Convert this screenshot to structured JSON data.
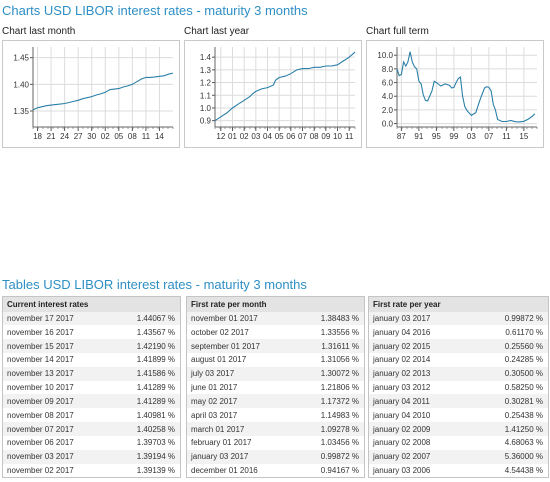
{
  "headings": {
    "charts": "Charts USD LIBOR interest rates - maturity 3 months",
    "tables": "Tables USD LIBOR interest rates - maturity 3 months"
  },
  "colors": {
    "accent": "#2e8fc5",
    "line": "#2a7fa8",
    "grid": "#dcdcdc"
  },
  "chart_data": [
    {
      "type": "line",
      "title": "Chart last month",
      "xlabel": "",
      "ylabel": "",
      "grid": true,
      "ylim": [
        1.32,
        1.47
      ],
      "xlim": [
        0,
        31
      ],
      "yticks": [
        1.35,
        1.4,
        1.45
      ],
      "ytick_labels": [
        "1.35",
        "1.40",
        "1.45"
      ],
      "x_tick_labels": [
        "18",
        "21",
        "24",
        "27",
        "30",
        "02",
        "05",
        "08",
        "11",
        "14"
      ],
      "x_tick_positions": [
        1,
        4,
        7,
        10,
        13,
        16,
        19,
        22,
        25,
        28
      ],
      "x": [
        0,
        1,
        2,
        3,
        4,
        5,
        6,
        7,
        8,
        9,
        10,
        11,
        12,
        13,
        14,
        15,
        16,
        17,
        18,
        19,
        20,
        21,
        22,
        23,
        24,
        25,
        26,
        27,
        28,
        29,
        30,
        31
      ],
      "values": [
        1.352,
        1.356,
        1.358,
        1.36,
        1.361,
        1.362,
        1.363,
        1.364,
        1.366,
        1.368,
        1.37,
        1.373,
        1.375,
        1.377,
        1.38,
        1.382,
        1.385,
        1.39,
        1.391,
        1.392,
        1.395,
        1.397,
        1.4,
        1.405,
        1.41,
        1.413,
        1.413,
        1.414,
        1.415,
        1.416,
        1.419,
        1.421
      ]
    },
    {
      "type": "line",
      "title": "Chart last year",
      "xlabel": "",
      "ylabel": "",
      "grid": true,
      "ylim": [
        0.85,
        1.48
      ],
      "xlim": [
        0,
        12
      ],
      "yticks": [
        0.9,
        1.0,
        1.1,
        1.2,
        1.3,
        1.4
      ],
      "ytick_labels": [
        "0.9",
        "1.0",
        "1.1",
        "1.2",
        "1.3",
        "1.4"
      ],
      "x_tick_labels": [
        "12",
        "01",
        "02",
        "03",
        "04",
        "05",
        "06",
        "07",
        "08",
        "09",
        "10",
        "11"
      ],
      "x_tick_positions": [
        0.5,
        1.5,
        2.5,
        3.5,
        4.5,
        5.5,
        6.5,
        7.5,
        8.5,
        9.5,
        10.5,
        11.5
      ],
      "x": [
        0,
        0.5,
        1,
        1.5,
        2,
        2.5,
        3,
        3.2,
        3.5,
        4,
        4.5,
        5,
        5.2,
        5.5,
        6,
        6.5,
        7,
        7.5,
        8,
        8.5,
        9,
        9.5,
        10,
        10.5,
        11,
        11.5,
        12
      ],
      "values": [
        0.9,
        0.93,
        0.96,
        1.0,
        1.03,
        1.06,
        1.09,
        1.11,
        1.13,
        1.15,
        1.16,
        1.18,
        1.22,
        1.24,
        1.25,
        1.27,
        1.3,
        1.31,
        1.31,
        1.32,
        1.32,
        1.33,
        1.33,
        1.34,
        1.37,
        1.4,
        1.44
      ]
    },
    {
      "type": "line",
      "title": "Chart full term",
      "xlabel": "",
      "ylabel": "",
      "grid": true,
      "ylim": [
        -0.5,
        11.2
      ],
      "xlim": [
        1986,
        2018
      ],
      "yticks": [
        0,
        2,
        4,
        6,
        8,
        10
      ],
      "ytick_labels": [
        "0.0",
        "2.0",
        "4.0",
        "6.0",
        "8.0",
        "10.0"
      ],
      "x_tick_labels": [
        "87",
        "91",
        "95",
        "99",
        "03",
        "07",
        "11",
        "15"
      ],
      "x_tick_positions": [
        1987,
        1991,
        1995,
        1999,
        2003,
        2007,
        2011,
        2015
      ],
      "x": [
        1986,
        1986.5,
        1987,
        1987.5,
        1988,
        1988.5,
        1989,
        1989.5,
        1990,
        1990.5,
        1991,
        1991.5,
        1992,
        1992.5,
        1993,
        1994,
        1994.5,
        1995,
        1996,
        1997,
        1998,
        1998.5,
        1999,
        1999.5,
        2000,
        2000.5,
        2001,
        2001.5,
        2002,
        2003,
        2004,
        2005,
        2006,
        2006.5,
        2007,
        2007.5,
        2008,
        2008.5,
        2009,
        2010,
        2011,
        2012,
        2013,
        2014,
        2015,
        2016,
        2017,
        2017.5
      ],
      "values": [
        8.0,
        7.0,
        7.2,
        9.0,
        8.4,
        9.0,
        10.5,
        9.0,
        8.3,
        8.0,
        6.2,
        5.8,
        4.2,
        3.4,
        3.3,
        4.8,
        6.2,
        6.0,
        5.5,
        5.8,
        5.6,
        5.2,
        5.3,
        6.0,
        6.6,
        6.8,
        4.0,
        2.5,
        1.9,
        1.2,
        1.6,
        3.5,
        5.2,
        5.4,
        5.3,
        4.8,
        2.8,
        2.0,
        0.6,
        0.3,
        0.3,
        0.45,
        0.28,
        0.24,
        0.33,
        0.65,
        1.1,
        1.44
      ]
    }
  ],
  "tables": [
    {
      "header": "Current interest rates",
      "rows": [
        [
          "november 17 2017",
          "1.44067 %"
        ],
        [
          "november 16 2017",
          "1.43567 %"
        ],
        [
          "november 15 2017",
          "1.42190 %"
        ],
        [
          "november 14 2017",
          "1.41899 %"
        ],
        [
          "november 13 2017",
          "1.41586 %"
        ],
        [
          "november 10 2017",
          "1.41289 %"
        ],
        [
          "november 09 2017",
          "1.41289 %"
        ],
        [
          "november 08 2017",
          "1.40981 %"
        ],
        [
          "november 07 2017",
          "1.40258 %"
        ],
        [
          "november 06 2017",
          "1.39703 %"
        ],
        [
          "november 03 2017",
          "1.39194 %"
        ],
        [
          "november 02 2017",
          "1.39139 %"
        ]
      ]
    },
    {
      "header": "First rate per month",
      "rows": [
        [
          "november 01 2017",
          "1.38483 %"
        ],
        [
          "october 02 2017",
          "1.33556 %"
        ],
        [
          "september 01 2017",
          "1.31611 %"
        ],
        [
          "august 01 2017",
          "1.31056 %"
        ],
        [
          "july 03 2017",
          "1.30072 %"
        ],
        [
          "june 01 2017",
          "1.21806 %"
        ],
        [
          "may 02 2017",
          "1.17372 %"
        ],
        [
          "april 03 2017",
          "1.14983 %"
        ],
        [
          "march 01 2017",
          "1.09278 %"
        ],
        [
          "february 01 2017",
          "1.03456 %"
        ],
        [
          "january 03 2017",
          "0.99872 %"
        ],
        [
          "december 01 2016",
          "0.94167 %"
        ]
      ]
    },
    {
      "header": "First rate per year",
      "rows": [
        [
          "january 03 2017",
          "0.99872 %"
        ],
        [
          "january 04 2016",
          "0.61170 %"
        ],
        [
          "january 02 2015",
          "0.25560 %"
        ],
        [
          "january 02 2014",
          "0.24285 %"
        ],
        [
          "january 02 2013",
          "0.30500 %"
        ],
        [
          "january 03 2012",
          "0.58250 %"
        ],
        [
          "january 04 2011",
          "0.30281 %"
        ],
        [
          "january 04 2010",
          "0.25438 %"
        ],
        [
          "january 02 2009",
          "1.41250 %"
        ],
        [
          "january 02 2008",
          "4.68063 %"
        ],
        [
          "january 02 2007",
          "5.36000 %"
        ],
        [
          "january 03 2006",
          "4.54438 %"
        ]
      ]
    }
  ]
}
